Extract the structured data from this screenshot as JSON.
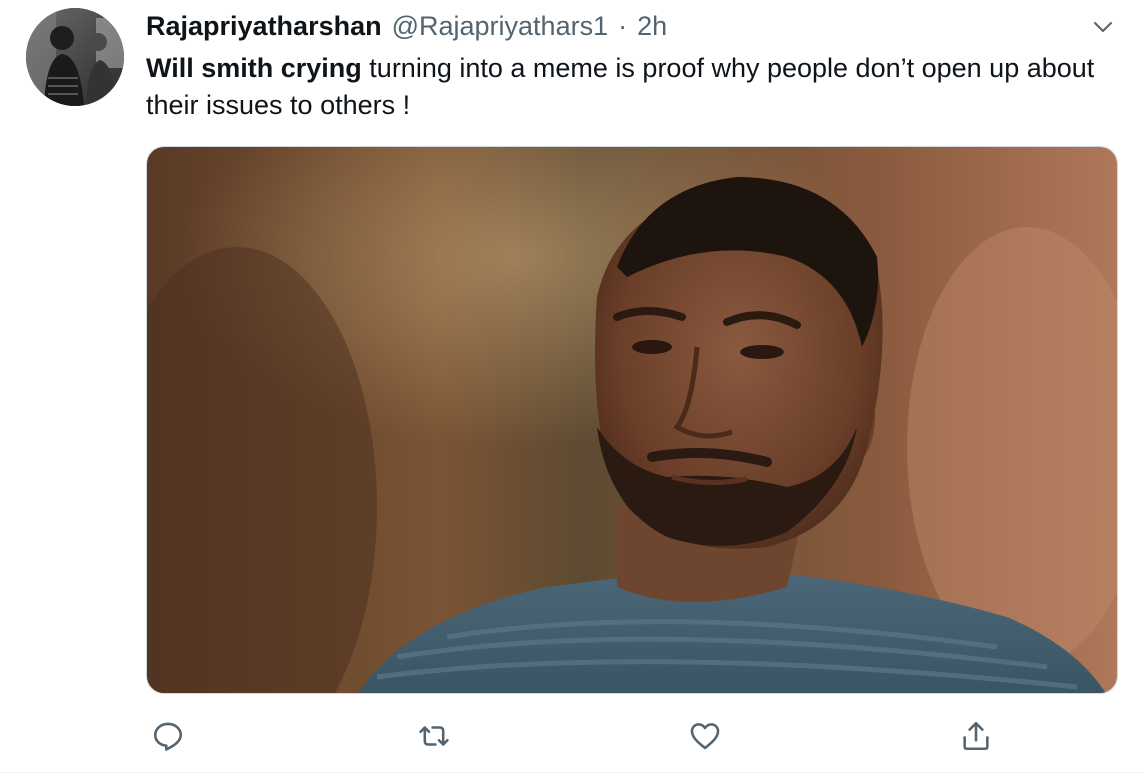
{
  "tweet": {
    "display_name": "Rajapriyatharshan",
    "handle": "@Rajapriyathars1",
    "separator": "·",
    "time": "2h",
    "text_bold": "Will smith crying",
    "text_rest": " turning into a meme is proof why people don’t open up about their issues to others !"
  },
  "actions": {
    "reply_icon": "speech-bubble-icon",
    "retweet_icon": "retweet-arrows-icon",
    "like_icon": "heart-icon",
    "share_icon": "share-upload-icon"
  },
  "colors": {
    "text_primary": "#0f1419",
    "text_secondary": "#536471",
    "icon_gray": "#536471",
    "divider": "#eff3f4"
  }
}
